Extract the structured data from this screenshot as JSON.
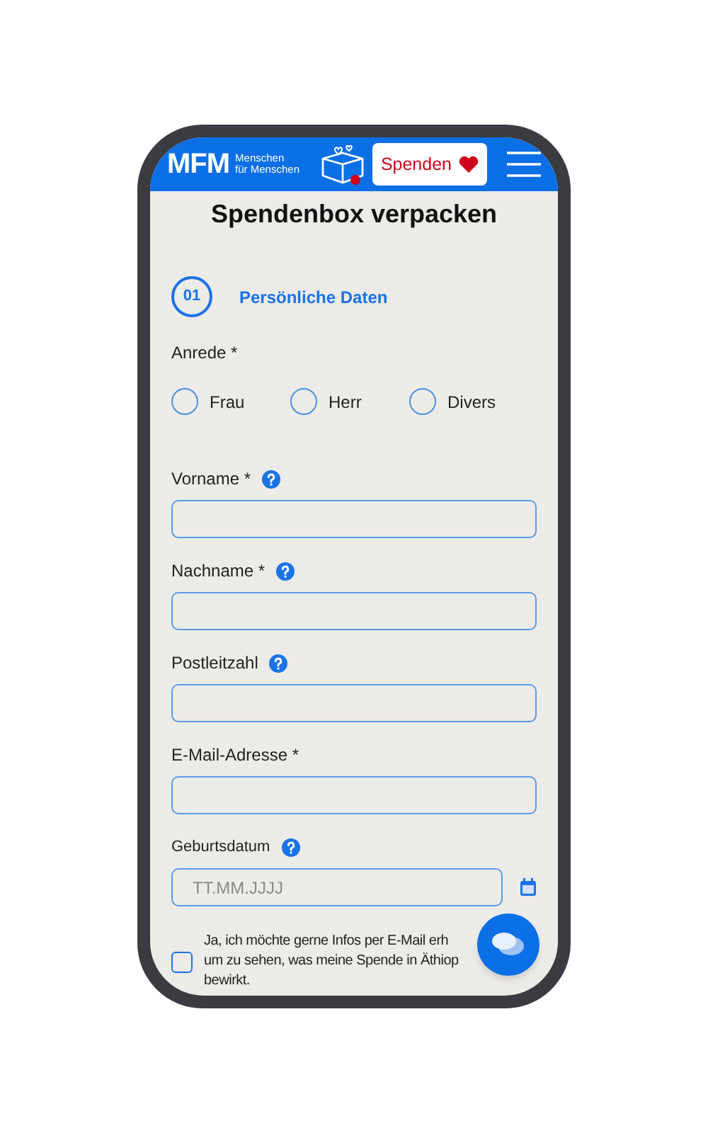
{
  "header": {
    "logo_mark": "MFM",
    "logo_lines": [
      "Menschen",
      "für Menschen"
    ],
    "donate_button": "Spenden"
  },
  "title": "Spendenbox verpacken",
  "step": {
    "number": "01",
    "label": "Persönliche Daten"
  },
  "salutation": {
    "label": "Anrede *",
    "options": [
      {
        "label": "Frau",
        "selected": false
      },
      {
        "label": "Herr",
        "selected": false
      },
      {
        "label": "Divers",
        "selected": false
      }
    ]
  },
  "fields": [
    {
      "label": "Vorname *",
      "help": true,
      "kind": "text"
    },
    {
      "label": "Nachname *",
      "help": true,
      "kind": "text"
    },
    {
      "label": "Postleitzahl",
      "help": true,
      "kind": "text"
    },
    {
      "label": "E-Mail-Adresse *",
      "help": false,
      "kind": "text"
    },
    {
      "label": "Geburtsdatum",
      "help": true,
      "kind": "date",
      "placeholder": "TT.MM.JJJJ"
    }
  ],
  "newsletter": {
    "checked": false,
    "lines": [
      "Ja, ich möchte gerne Infos per E-Mail erh",
      "um zu sehen, was meine Spende in Äthiop",
      "bewirkt."
    ]
  }
}
